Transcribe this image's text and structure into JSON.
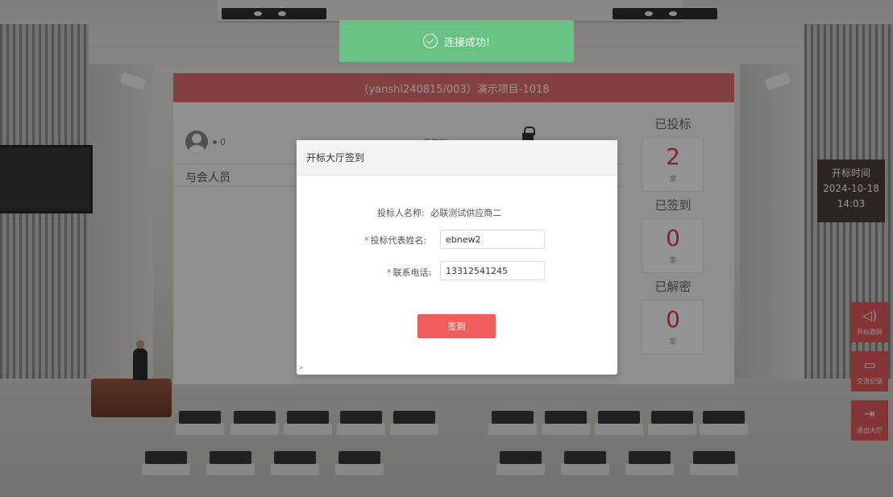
{
  "toast": {
    "text": "连接成功!"
  },
  "header": {
    "title": "（yanshi240815/003）演示项目-1018"
  },
  "hall": {
    "online_count": "0",
    "attendees_label": "与会人员",
    "signed_small": "已签到"
  },
  "stats": [
    {
      "title": "已投标",
      "value": "2",
      "unit": "家"
    },
    {
      "title": "已签到",
      "value": "0",
      "unit": "家"
    },
    {
      "title": "已解密",
      "value": "0",
      "unit": "家"
    }
  ],
  "time_panel": {
    "label": "开标时间",
    "date": "2024-10-18",
    "time": "14:03"
  },
  "side_buttons": [
    {
      "label": "开标致辞",
      "icon": "speaker-icon"
    },
    {
      "label": "交流记录",
      "icon": "chat-icon"
    },
    {
      "label": "退出大厅",
      "icon": "exit-icon"
    }
  ],
  "modal": {
    "title": "开标大厅签到",
    "bidder_label": "投标人名称:",
    "bidder_value": "必联测试供应商二",
    "rep_label": "投标代表姓名:",
    "rep_value": "ebnew2",
    "phone_label": "联系电话:",
    "phone_value": "13312541245",
    "submit_label": "签到",
    "caret": ">"
  },
  "colors": {
    "accent": "#e46f6f",
    "success": "#67c283",
    "button": "#f15c5c"
  }
}
